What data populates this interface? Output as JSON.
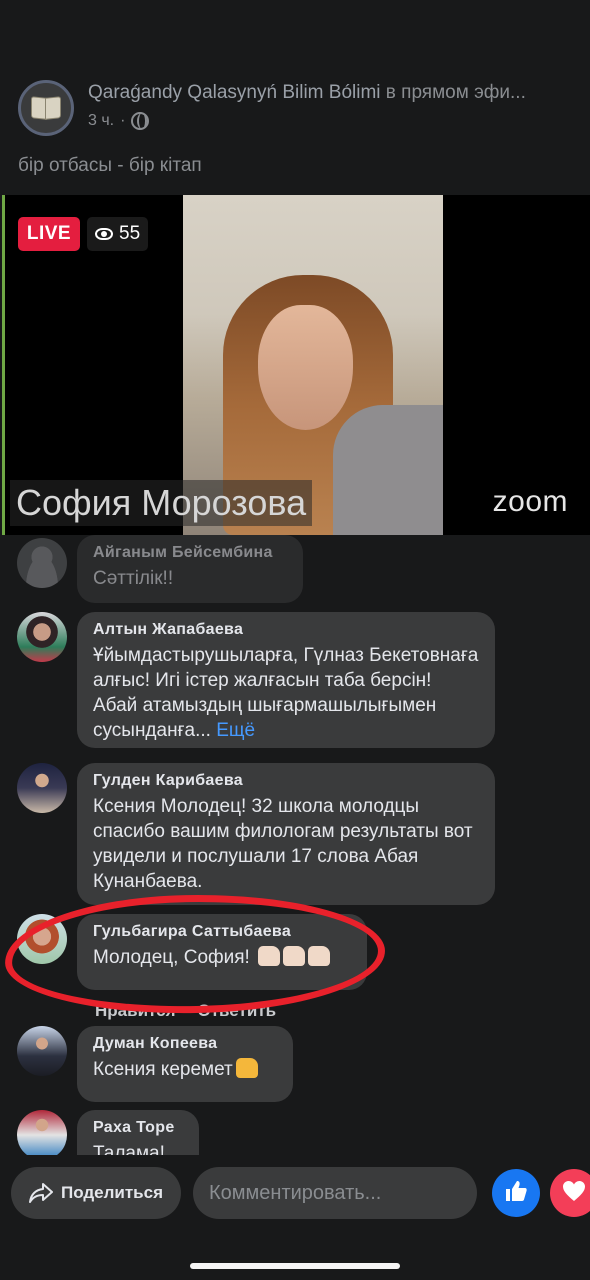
{
  "post": {
    "page_name": "Qaraǵandy Qalasynyń Bilim Bólimi",
    "status_suffix": "в прямом эфи...",
    "time": "3 ч.",
    "separator": "·",
    "text": "бір отбасы - бір кітап"
  },
  "video": {
    "live_label": "LIVE",
    "viewer_count": "55",
    "speaker_name": "София Морозова",
    "brand": "zoom"
  },
  "comments": [
    {
      "author": "Айганым Бейсембина",
      "text": "Сәттілік!!"
    },
    {
      "author": "Алтын Жапабаева",
      "text": "Ұйымдастырушыларға, Гүлназ Бекетовнаға алғыс! Игі істер жалғасын таба берсін! Абай атамыздың шығармашылығымен сусынданға...",
      "more": "Ещё"
    },
    {
      "author": "Гулден Карибаева",
      "text": "Ксения Молодец! 32 школа молодцы спасибо вашим филологам результаты вот увидели и послушали 17 слова Абая Кунанбаева."
    },
    {
      "author": "Гульбагира Саттыбаева",
      "text": "Молодец, София!"
    },
    {
      "author": "Думан Копеева",
      "text": "Ксения керемет"
    },
    {
      "author": "Раха Торе",
      "text": "Талама!"
    }
  ],
  "comment_actions": {
    "like": "Нравится",
    "reply": "Ответить"
  },
  "bottom_bar": {
    "share_label": "Поделиться",
    "comment_placeholder": "Комментировать..."
  },
  "colors": {
    "background": "#18191a",
    "bubble": "#3a3b3c",
    "live_red": "#e41e3f",
    "link_blue": "#4599ff",
    "like_blue": "#1877f2",
    "love_red": "#f33e58",
    "annotation_red": "#e8212b"
  },
  "icons": [
    "book-logo-icon",
    "globe-icon",
    "eye-icon",
    "share-arrow-icon",
    "thumbs-up-icon",
    "heart-icon"
  ]
}
